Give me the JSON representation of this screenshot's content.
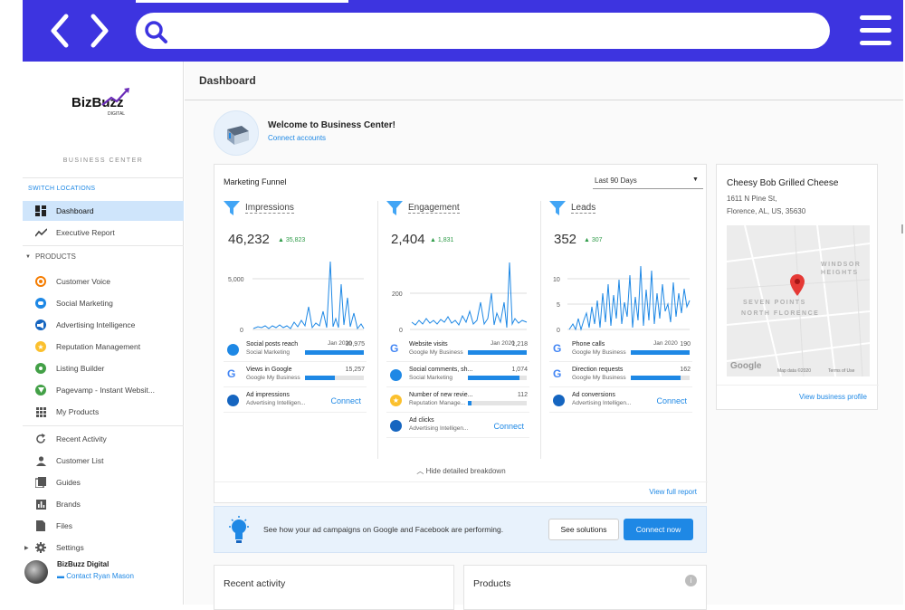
{
  "topbar": {
    "accent": "#3d34e0",
    "search_placeholder": ""
  },
  "sidebar": {
    "business_center_label": "BUSINESS CENTER",
    "switch_locations": "SWITCH LOCATIONS",
    "items": [
      {
        "label": "Dashboard",
        "icon": "dashboard-icon",
        "active": true
      },
      {
        "label": "Executive Report",
        "icon": "trend-icon"
      }
    ],
    "products_header": "PRODUCTS",
    "products": [
      {
        "label": "Customer Voice",
        "icon": "customer-voice-icon",
        "color": "#f57c00"
      },
      {
        "label": "Social Marketing",
        "icon": "social-marketing-icon",
        "color": "#1e88e5"
      },
      {
        "label": "Advertising Intelligence",
        "icon": "advertising-icon",
        "color": "#1565c0"
      },
      {
        "label": "Reputation Management",
        "icon": "reputation-star-icon",
        "color": "#fbc02d"
      },
      {
        "label": "Listing Builder",
        "icon": "listing-pin-icon",
        "color": "#43a047"
      },
      {
        "label": "Pagevamp - Instant Websit...",
        "icon": "pagevamp-icon",
        "color": "#43a047"
      },
      {
        "label": "My Products",
        "icon": "apps-grid-icon"
      }
    ],
    "tools": [
      {
        "label": "Recent Activity",
        "icon": "refresh-icon"
      },
      {
        "label": "Customer List",
        "icon": "person-icon"
      },
      {
        "label": "Guides",
        "icon": "guides-icon"
      },
      {
        "label": "Brands",
        "icon": "brands-chart-icon"
      },
      {
        "label": "Files",
        "icon": "file-icon"
      },
      {
        "label": "Settings",
        "icon": "gear-icon"
      }
    ],
    "user": {
      "name": "BizBuzz Digital",
      "contact": "Contact Ryan Mason"
    }
  },
  "main": {
    "page_title": "Dashboard",
    "welcome": {
      "title": "Welcome to Business Center!",
      "link": "Connect accounts"
    },
    "funnel": {
      "title": "Marketing Funnel",
      "range": "Last 90 Days",
      "hide_breakdown": "Hide detailed breakdown",
      "full_report": "View full report",
      "columns": [
        {
          "label": "Impressions",
          "total": "46,232",
          "delta": "35,823",
          "y_ticks": [
            "5,000",
            "0"
          ],
          "x_label": "Jan 2020",
          "metrics": [
            {
              "name": "Social posts reach",
              "source": "Social Marketing",
              "value": "30,975",
              "fill": 1.0,
              "icon": "social-marketing-icon"
            },
            {
              "name": "Views in Google",
              "source": "Google My Business",
              "value": "15,257",
              "fill": 0.5,
              "icon": "google-icon"
            },
            {
              "name": "Ad impressions",
              "source": "Advertising Intelligen...",
              "action": "Connect",
              "icon": "advertising-icon"
            }
          ]
        },
        {
          "label": "Engagement",
          "total": "2,404",
          "delta": "1,831",
          "y_ticks": [
            "200",
            "0"
          ],
          "x_label": "Jan 2020",
          "metrics": [
            {
              "name": "Website visits",
              "source": "Google My Business",
              "value": "1,218",
              "fill": 1.0,
              "icon": "google-icon"
            },
            {
              "name": "Social comments, sh...",
              "source": "Social Marketing",
              "value": "1,074",
              "fill": 0.88,
              "icon": "social-marketing-icon"
            },
            {
              "name": "Number of new revie...",
              "source": "Reputation Manage...",
              "value": "112",
              "fill": 0.06,
              "icon": "reputation-star-icon"
            },
            {
              "name": "Ad clicks",
              "source": "Advertising Intelligen...",
              "action": "Connect",
              "icon": "advertising-icon"
            }
          ]
        },
        {
          "label": "Leads",
          "total": "352",
          "delta": "307",
          "y_ticks": [
            "10",
            "5",
            "0"
          ],
          "x_label": "Jan 2020",
          "metrics": [
            {
              "name": "Phone calls",
              "source": "Google My Business",
              "value": "190",
              "fill": 1.0,
              "icon": "google-icon"
            },
            {
              "name": "Direction requests",
              "source": "Google My Business",
              "value": "162",
              "fill": 0.85,
              "icon": "google-icon"
            },
            {
              "name": "Ad conversions",
              "source": "Advertising Intelligen...",
              "action": "Connect",
              "icon": "advertising-icon"
            }
          ]
        }
      ]
    },
    "business": {
      "name": "Cheesy Bob Grilled Cheese",
      "address1": "1611 N Pine St,",
      "address2": "Florence, AL, US, 35630",
      "map_labels": [
        "WINDSOR",
        "HEIGHTS",
        "SEVEN POINTS",
        "NORTH FLORENCE"
      ],
      "map_footer": [
        "Map data ©2020",
        "Terms of Use"
      ],
      "map_brand": "Google",
      "view_profile": "View business profile"
    },
    "ad_banner": {
      "text": "See how your ad campaigns on Google and Facebook are performing.",
      "solutions_button": "See solutions",
      "connect_button": "Connect now"
    },
    "recent_activity_title": "Recent activity",
    "products_title": "Products"
  },
  "colors": {
    "primary": "#1e88e5",
    "positive": "#2e9b48",
    "funnel": "#42a5f5"
  }
}
